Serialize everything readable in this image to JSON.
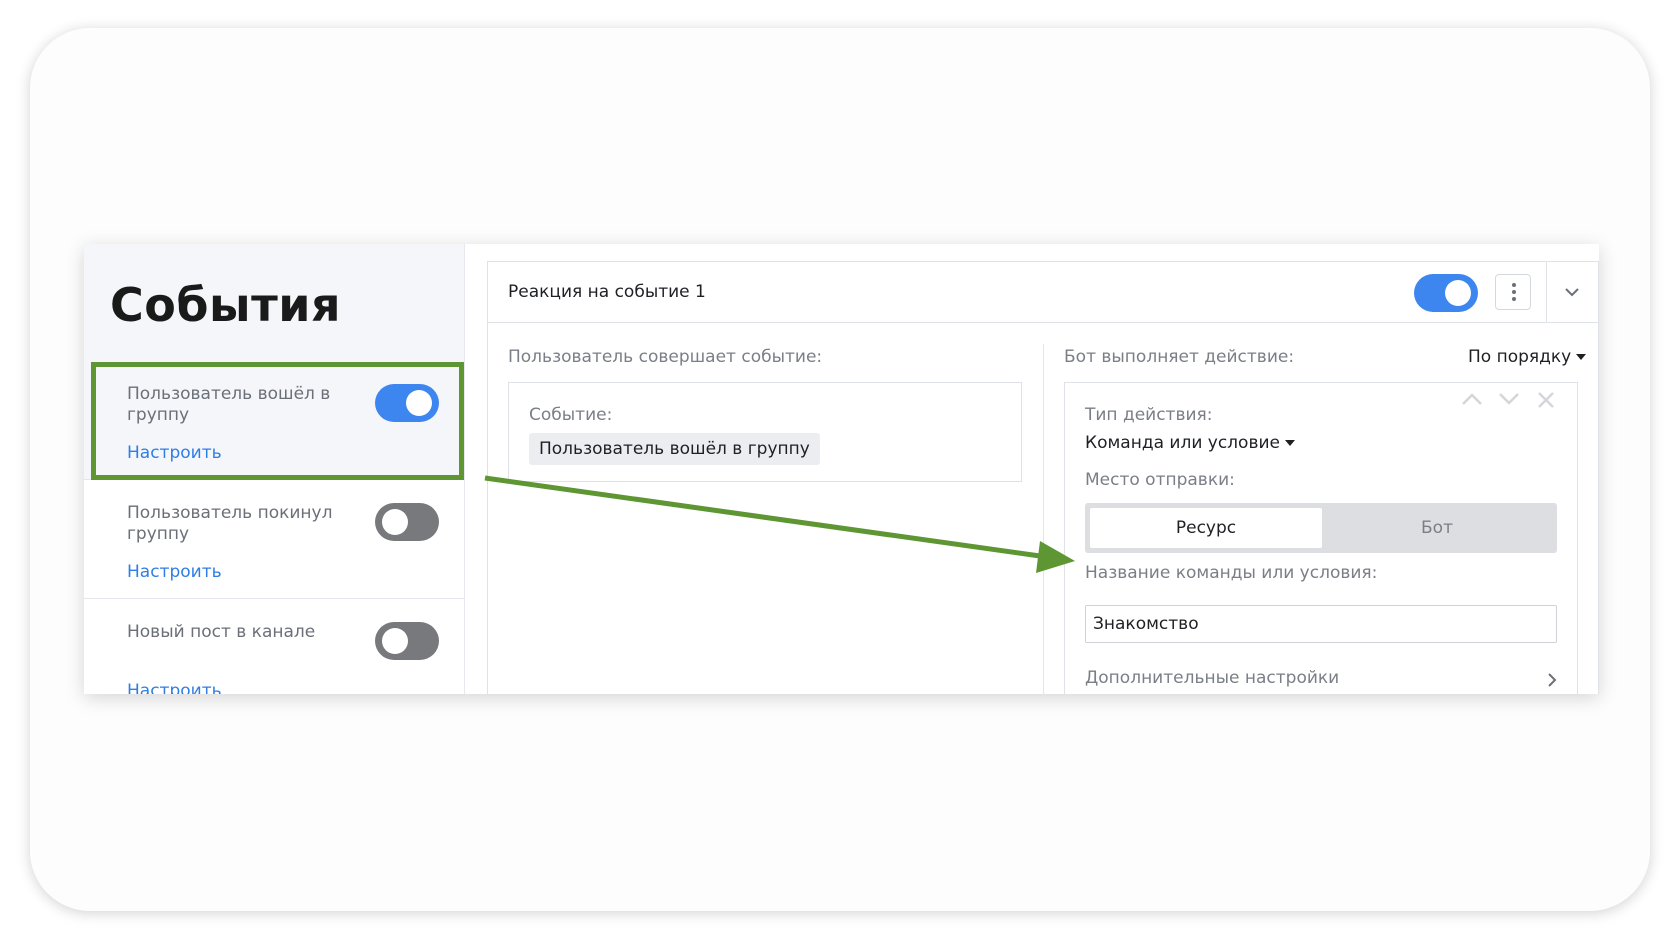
{
  "sidebar": {
    "title": "События",
    "items": [
      {
        "label": "Пользователь вошёл в группу",
        "link": "Настроить",
        "enabled": true,
        "highlighted": true
      },
      {
        "label": "Пользователь покинул группу",
        "link": "Настроить",
        "enabled": false,
        "highlighted": false
      },
      {
        "label": "Новый пост в канале",
        "link": "Настроить",
        "enabled": false,
        "highlighted": false
      }
    ]
  },
  "reaction": {
    "title": "Реакция на событие 1",
    "enabled": true,
    "more_icon": "kebab-vertical-icon",
    "collapse_icon": "chevron-down-icon",
    "left_column": {
      "title": "Пользователь совершает событие:",
      "event_label": "Событие:",
      "event_value": "Пользователь вошёл в группу"
    },
    "right_column": {
      "title": "Бот выполняет действие:",
      "order_select": "По порядку",
      "action": {
        "type_label": "Тип действия:",
        "type_value": "Команда или условие",
        "destination_label": "Место отправки:",
        "destination_options": [
          "Ресурс",
          "Бот"
        ],
        "destination_selected": "Ресурс",
        "name_label": "Название команды или условия:",
        "name_value": "Знакомство",
        "extra_settings": "Дополнительные настройки",
        "controls": [
          "move-up-icon",
          "move-down-icon",
          "close-icon"
        ]
      }
    }
  },
  "colors": {
    "accent": "#3d86f0",
    "link": "#2f7ee6",
    "highlight": "#5d9632",
    "toggle_off": "#78797d"
  }
}
